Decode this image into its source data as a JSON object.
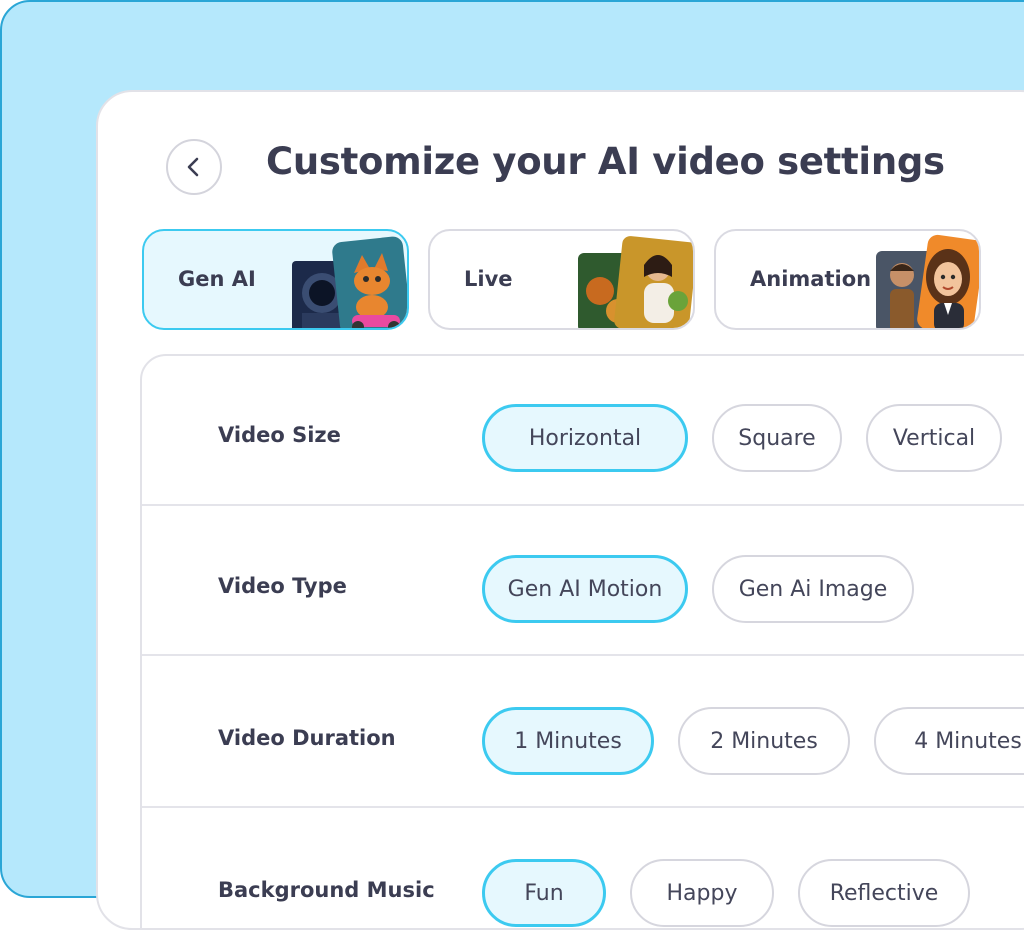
{
  "header": {
    "title": "Customize your AI video settings"
  },
  "modes": [
    {
      "label": "Gen AI",
      "selected": true
    },
    {
      "label": "Live",
      "selected": false
    },
    {
      "label": "Animation",
      "selected": false
    }
  ],
  "settings": {
    "video_size": {
      "label": "Video Size",
      "options": [
        "Horizontal",
        "Square",
        "Vertical"
      ],
      "selected": "Horizontal"
    },
    "video_type": {
      "label": "Video Type",
      "options": [
        "Gen AI Motion",
        "Gen Ai Image"
      ],
      "selected": "Gen AI Motion"
    },
    "video_duration": {
      "label": "Video Duration",
      "options": [
        "1 Minutes",
        "2 Minutes",
        "4 Minutes"
      ],
      "selected": "1 Minutes"
    },
    "background_music": {
      "label": "Background Music",
      "options": [
        "Fun",
        "Happy",
        "Reflective"
      ],
      "selected": "Fun"
    }
  },
  "colors": {
    "accent": "#3ccaf0",
    "accent_bg": "#e6f8fe",
    "outer_bg": "#b5e8fc",
    "text": "#3b3d52"
  }
}
